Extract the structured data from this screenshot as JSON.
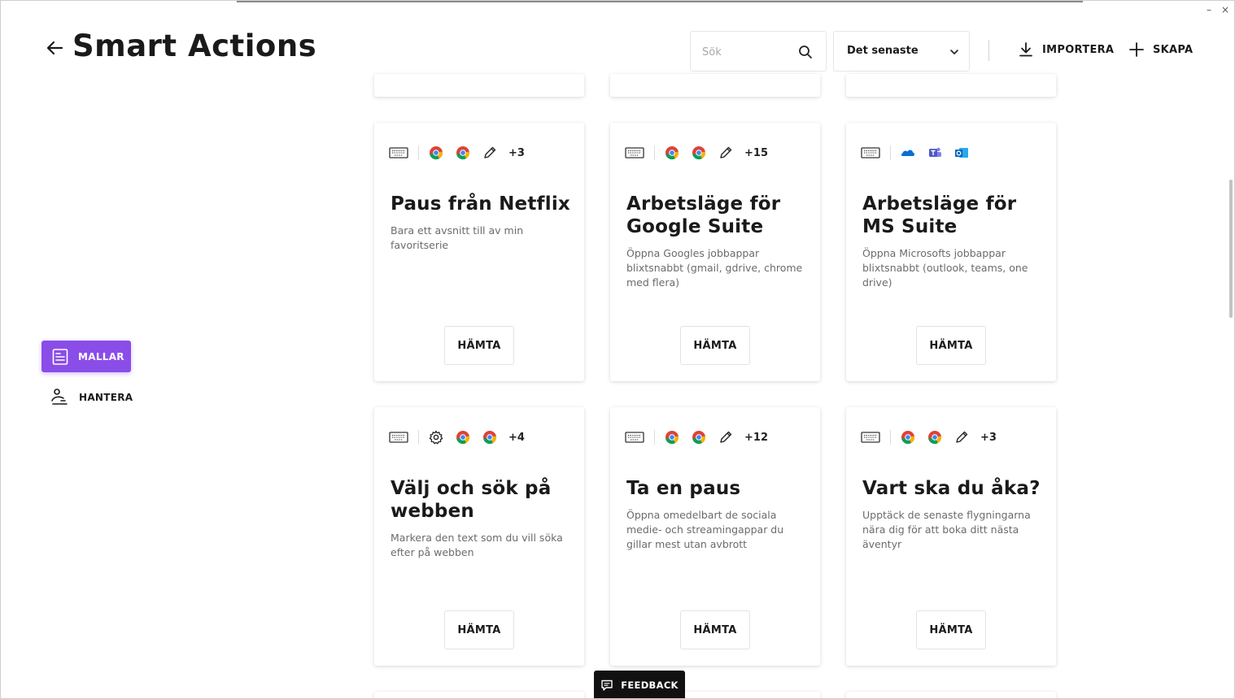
{
  "window": {
    "minimize_glyph": "–",
    "close_glyph": "×"
  },
  "header": {
    "title": "Smart Actions",
    "search_placeholder": "Sök",
    "sort_value": "Det senaste",
    "import_label": "IMPORTERA",
    "create_label": "SKAPA"
  },
  "sidebar": {
    "items": [
      {
        "label": "MALLAR",
        "icon": "template-icon",
        "active": true
      },
      {
        "label": "HANTERA",
        "icon": "manage-icon",
        "active": false
      }
    ]
  },
  "cards": [
    {
      "title": "Paus från Netflix",
      "description": "Bara ett avsnitt till av min favoritserie",
      "apps": [
        "chrome-icon",
        "chrome-icon",
        "pencil-icon"
      ],
      "more": "+3",
      "button": "HÄMTA"
    },
    {
      "title": "Arbetsläge för Google Suite",
      "description": "Öppna Googles jobbappar blixtsnabbt (gmail, gdrive, chrome med flera)",
      "apps": [
        "chrome-icon",
        "chrome-icon",
        "pencil-icon"
      ],
      "more": "+15",
      "button": "HÄMTA"
    },
    {
      "title": "Arbetsläge för MS Suite",
      "description": "Öppna Microsofts jobbappar blixtsnabbt (outlook, teams, one drive)",
      "apps": [
        "onedrive-icon",
        "teams-icon",
        "outlook-icon"
      ],
      "more": "",
      "button": "HÄMTA"
    },
    {
      "title": "Välj och sök på webben",
      "description": "Markera den text som du vill söka efter på webben",
      "apps": [
        "gear-icon",
        "chrome-icon",
        "chrome-icon"
      ],
      "more": "+4",
      "button": "HÄMTA"
    },
    {
      "title": "Ta en paus",
      "description": "Öppna omedelbart de sociala medie- och streamingappar du gillar mest utan avbrott",
      "apps": [
        "chrome-icon",
        "chrome-icon",
        "pencil-icon"
      ],
      "more": "+12",
      "button": "HÄMTA"
    },
    {
      "title": "Vart ska du åka?",
      "description": "Upptäck de senaste flygningarna nära dig för att boka ditt nästa äventyr",
      "apps": [
        "chrome-icon",
        "chrome-icon",
        "pencil-icon"
      ],
      "more": "+3",
      "button": "HÄMTA"
    }
  ],
  "feedback_label": "FEEDBACK",
  "colors": {
    "accent": "#8a4de8"
  }
}
